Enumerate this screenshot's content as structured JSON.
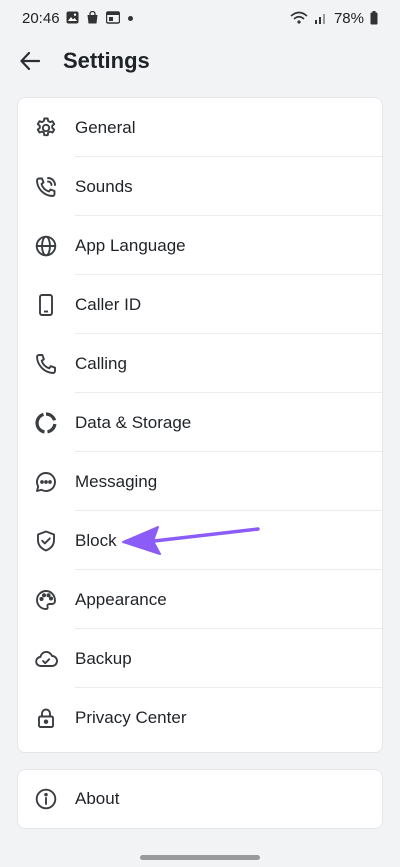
{
  "status_bar": {
    "time": "20:46",
    "battery": "78%",
    "icons": [
      "gallery-icon",
      "bag-icon",
      "media-icon",
      "wifi-icon",
      "signal-icon",
      "battery-icon"
    ]
  },
  "header": {
    "title": "Settings",
    "back_icon": "arrow-left-icon"
  },
  "settings": {
    "items": [
      {
        "label": "General",
        "icon": "gear-icon"
      },
      {
        "label": "Sounds",
        "icon": "phone-ring-icon"
      },
      {
        "label": "App Language",
        "icon": "globe-icon"
      },
      {
        "label": "Caller ID",
        "icon": "mobile-phone-icon"
      },
      {
        "label": "Calling",
        "icon": "phone-icon"
      },
      {
        "label": "Data & Storage",
        "icon": "donut-icon"
      },
      {
        "label": "Messaging",
        "icon": "chat-bubble-icon"
      },
      {
        "label": "Block",
        "icon": "shield-check-icon"
      },
      {
        "label": "Appearance",
        "icon": "palette-icon"
      },
      {
        "label": "Backup",
        "icon": "cloud-check-icon"
      },
      {
        "label": "Privacy Center",
        "icon": "lock-icon"
      }
    ],
    "about": {
      "label": "About",
      "icon": "info-icon"
    }
  },
  "colors": {
    "background": "#f2f3f5",
    "card": "#ffffff",
    "text": "#1f2328",
    "icon": "#3a3d42",
    "annotation": "#8b5cf6"
  }
}
